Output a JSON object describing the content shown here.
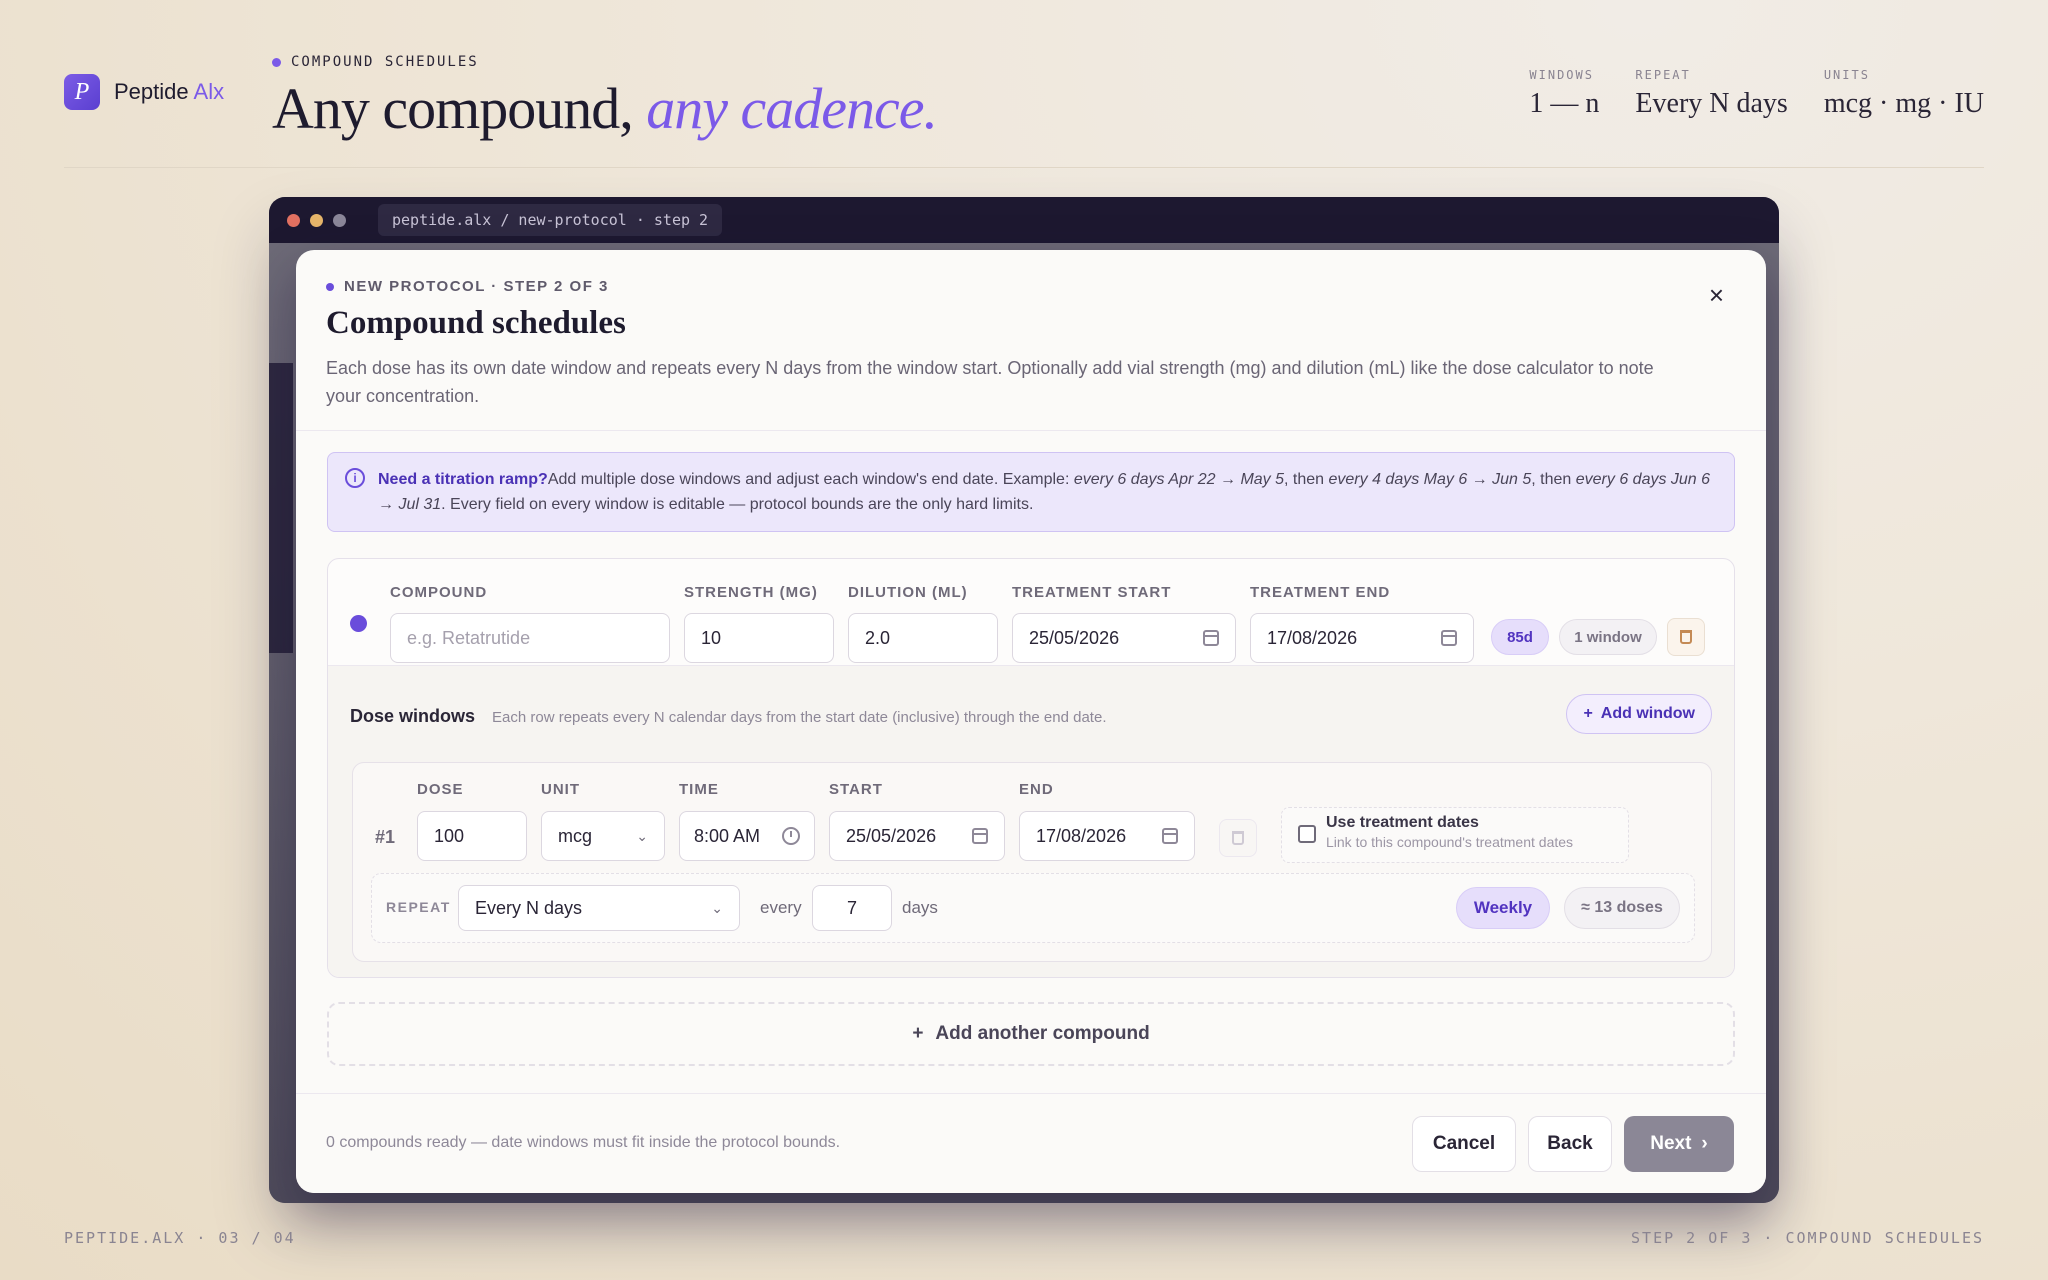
{
  "brand": {
    "logo_letter": "P",
    "name": "Peptide",
    "accent": "Alx"
  },
  "hero": {
    "eyebrow": "COMPOUND SCHEDULES",
    "title_plain": "Any compound,",
    "title_italic": "any cadence."
  },
  "stats": [
    {
      "label": "WINDOWS",
      "value": "1 — n"
    },
    {
      "label": "REPEAT",
      "value": "Every N days"
    },
    {
      "label": "UNITS",
      "value": "mcg · mg · IU"
    }
  ],
  "browser": {
    "url": "peptide.alx / new-protocol · step 2"
  },
  "modal": {
    "step": "NEW PROTOCOL · STEP 2 OF 3",
    "title": "Compound schedules",
    "description": "Each dose has its own date window and repeats every N days from the window start. Optionally add vial strength (mg) and dilution (mL) like the dose calculator to note your concentration.",
    "close": "×",
    "info": {
      "bold": "Need a titration ramp?",
      "text1": "Add multiple dose windows and adjust each window's end date. Example: ",
      "ex1": "every 6 days Apr 22 → May 5",
      "text2": ", then ",
      "ex2": "every 4 days May 6 → Jun 5",
      "text3": ", then ",
      "ex3": "every 6 days Jun 6 → Jul 31",
      "text4": ". Every field on every window is editable — protocol bounds are the only hard limits."
    }
  },
  "compound": {
    "labels": {
      "compound": "COMPOUND",
      "strength": "STRENGTH (MG)",
      "dilution": "DILUTION (ML)",
      "start": "TREATMENT START",
      "end": "TREATMENT END"
    },
    "compound_placeholder": "e.g. Retatrutide",
    "strength": "10",
    "dilution": "2.0",
    "start": "25/05/2026",
    "end": "17/08/2026",
    "duration_badge": "85d",
    "windows_badge": "1 window"
  },
  "dose_windows": {
    "title": "Dose windows",
    "subtitle": "Each row repeats every N calendar days from the start date (inclusive) through the end date.",
    "add_button": "Add window",
    "labels": {
      "dose": "DOSE",
      "unit": "UNIT",
      "time": "TIME",
      "start": "START",
      "end": "END"
    },
    "rows": [
      {
        "num": "#1",
        "dose": "100",
        "unit": "mcg",
        "time": "8:00 AM",
        "start": "25/05/2026",
        "end": "17/08/2026",
        "use_dates_title": "Use treatment dates",
        "use_dates_sub": "Link to this compound's treatment dates",
        "repeat_label": "REPEAT",
        "repeat_mode": "Every N days",
        "every": "every",
        "interval": "7",
        "days": "days",
        "cadence_badge": "Weekly",
        "count_badge": "≈ 13 doses"
      }
    ]
  },
  "add_compound": "Add another compound",
  "footer": {
    "note": "0 compounds ready — date windows must fit inside the protocol bounds.",
    "cancel": "Cancel",
    "back": "Back",
    "next": "Next"
  },
  "page_footer": {
    "left": "PEPTIDE.ALX · 03 / 04",
    "right": "STEP 2 OF 3 · COMPOUND SCHEDULES"
  },
  "colors": {
    "accent": "#7b5ae8",
    "accent_dark": "#5234c0",
    "frame_bar": "#1d1830"
  }
}
